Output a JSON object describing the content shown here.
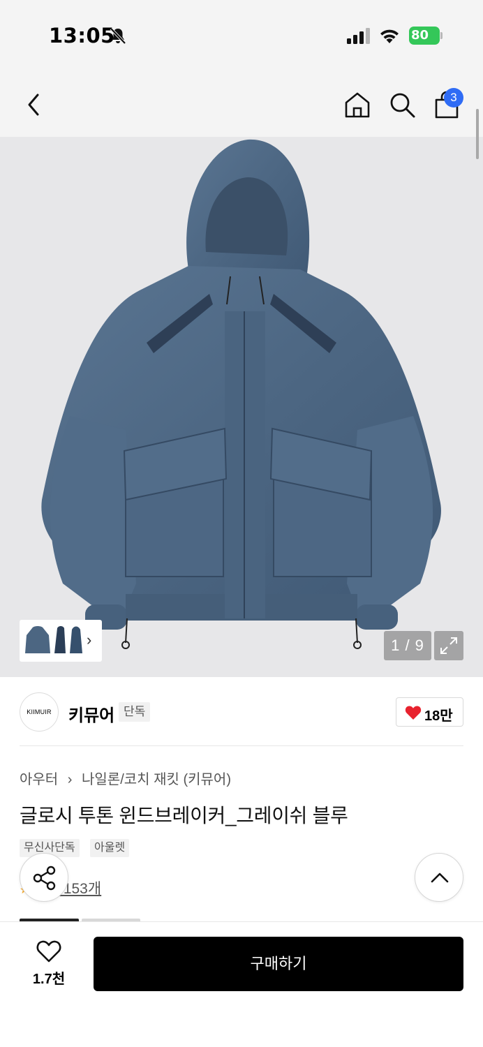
{
  "status_bar": {
    "time": "13:05",
    "battery": "80",
    "icons": [
      "bell-slash-icon",
      "signal-icon",
      "wifi-icon",
      "battery-charging-icon"
    ]
  },
  "nav": {
    "icons": [
      "chevron-left-icon",
      "home-icon",
      "search-icon",
      "shopping-bag-icon"
    ],
    "cart_count": "3"
  },
  "gallery": {
    "page_indicator": "1 / 9",
    "thumbnail_icons": [
      "jacket-thumbnail"
    ],
    "expand_icon": "expand-icon"
  },
  "brand": {
    "logo_text": "KIIMUIR",
    "name": "키뮤어",
    "exclusive_label": "단독",
    "likes": "18만"
  },
  "product": {
    "category": "아우터",
    "subcategory": "나일론/코치 재킷 (키뮤어)",
    "title": "글로시 투톤 윈드브레이커_그레이쉬 블루",
    "tags": [
      "무신사단독",
      "아울렛"
    ],
    "review_link": "후기 153개"
  },
  "floating": {
    "share_icon": "share-icon",
    "scroll_top_icon": "chevron-up-icon"
  },
  "bottom_bar": {
    "wish_count": "1.7천",
    "buy_label": "구매하기"
  },
  "colors": {
    "badge_blue": "#2f6cf5",
    "battery_green": "#34c759",
    "heart_red": "#e8222e",
    "jacket_blue": "#4f6a86"
  }
}
